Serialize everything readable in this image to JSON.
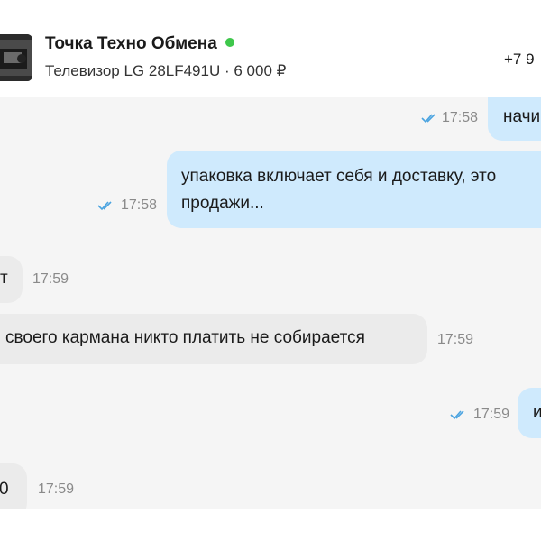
{
  "header": {
    "title": "Точка Техно Обмена",
    "subtitle": "Телевизор LG 28LF491U · 6 000 ₽",
    "phone": "+7 9"
  },
  "colors": {
    "online": "#3ec74b",
    "outgoing_bubble": "#cfeafd",
    "incoming_bubble": "#ebebeb",
    "read_ticks": "#4aa3e0"
  },
  "messages": [
    {
      "direction": "out",
      "text": "начи",
      "time": "17:58",
      "read": true
    },
    {
      "direction": "out",
      "text_line1": "упаковка включает себя и доставку, это",
      "text_line2": "продажи...",
      "time": "17:58",
      "read": true
    },
    {
      "direction": "in",
      "text": "т",
      "time": "17:59"
    },
    {
      "direction": "in",
      "text": "своего кармана никто платить не собирается",
      "time": "17:59"
    },
    {
      "direction": "out",
      "text": "и",
      "time": "17:59",
      "read": true
    },
    {
      "direction": "in",
      "text": "0",
      "time": "17:59"
    }
  ]
}
